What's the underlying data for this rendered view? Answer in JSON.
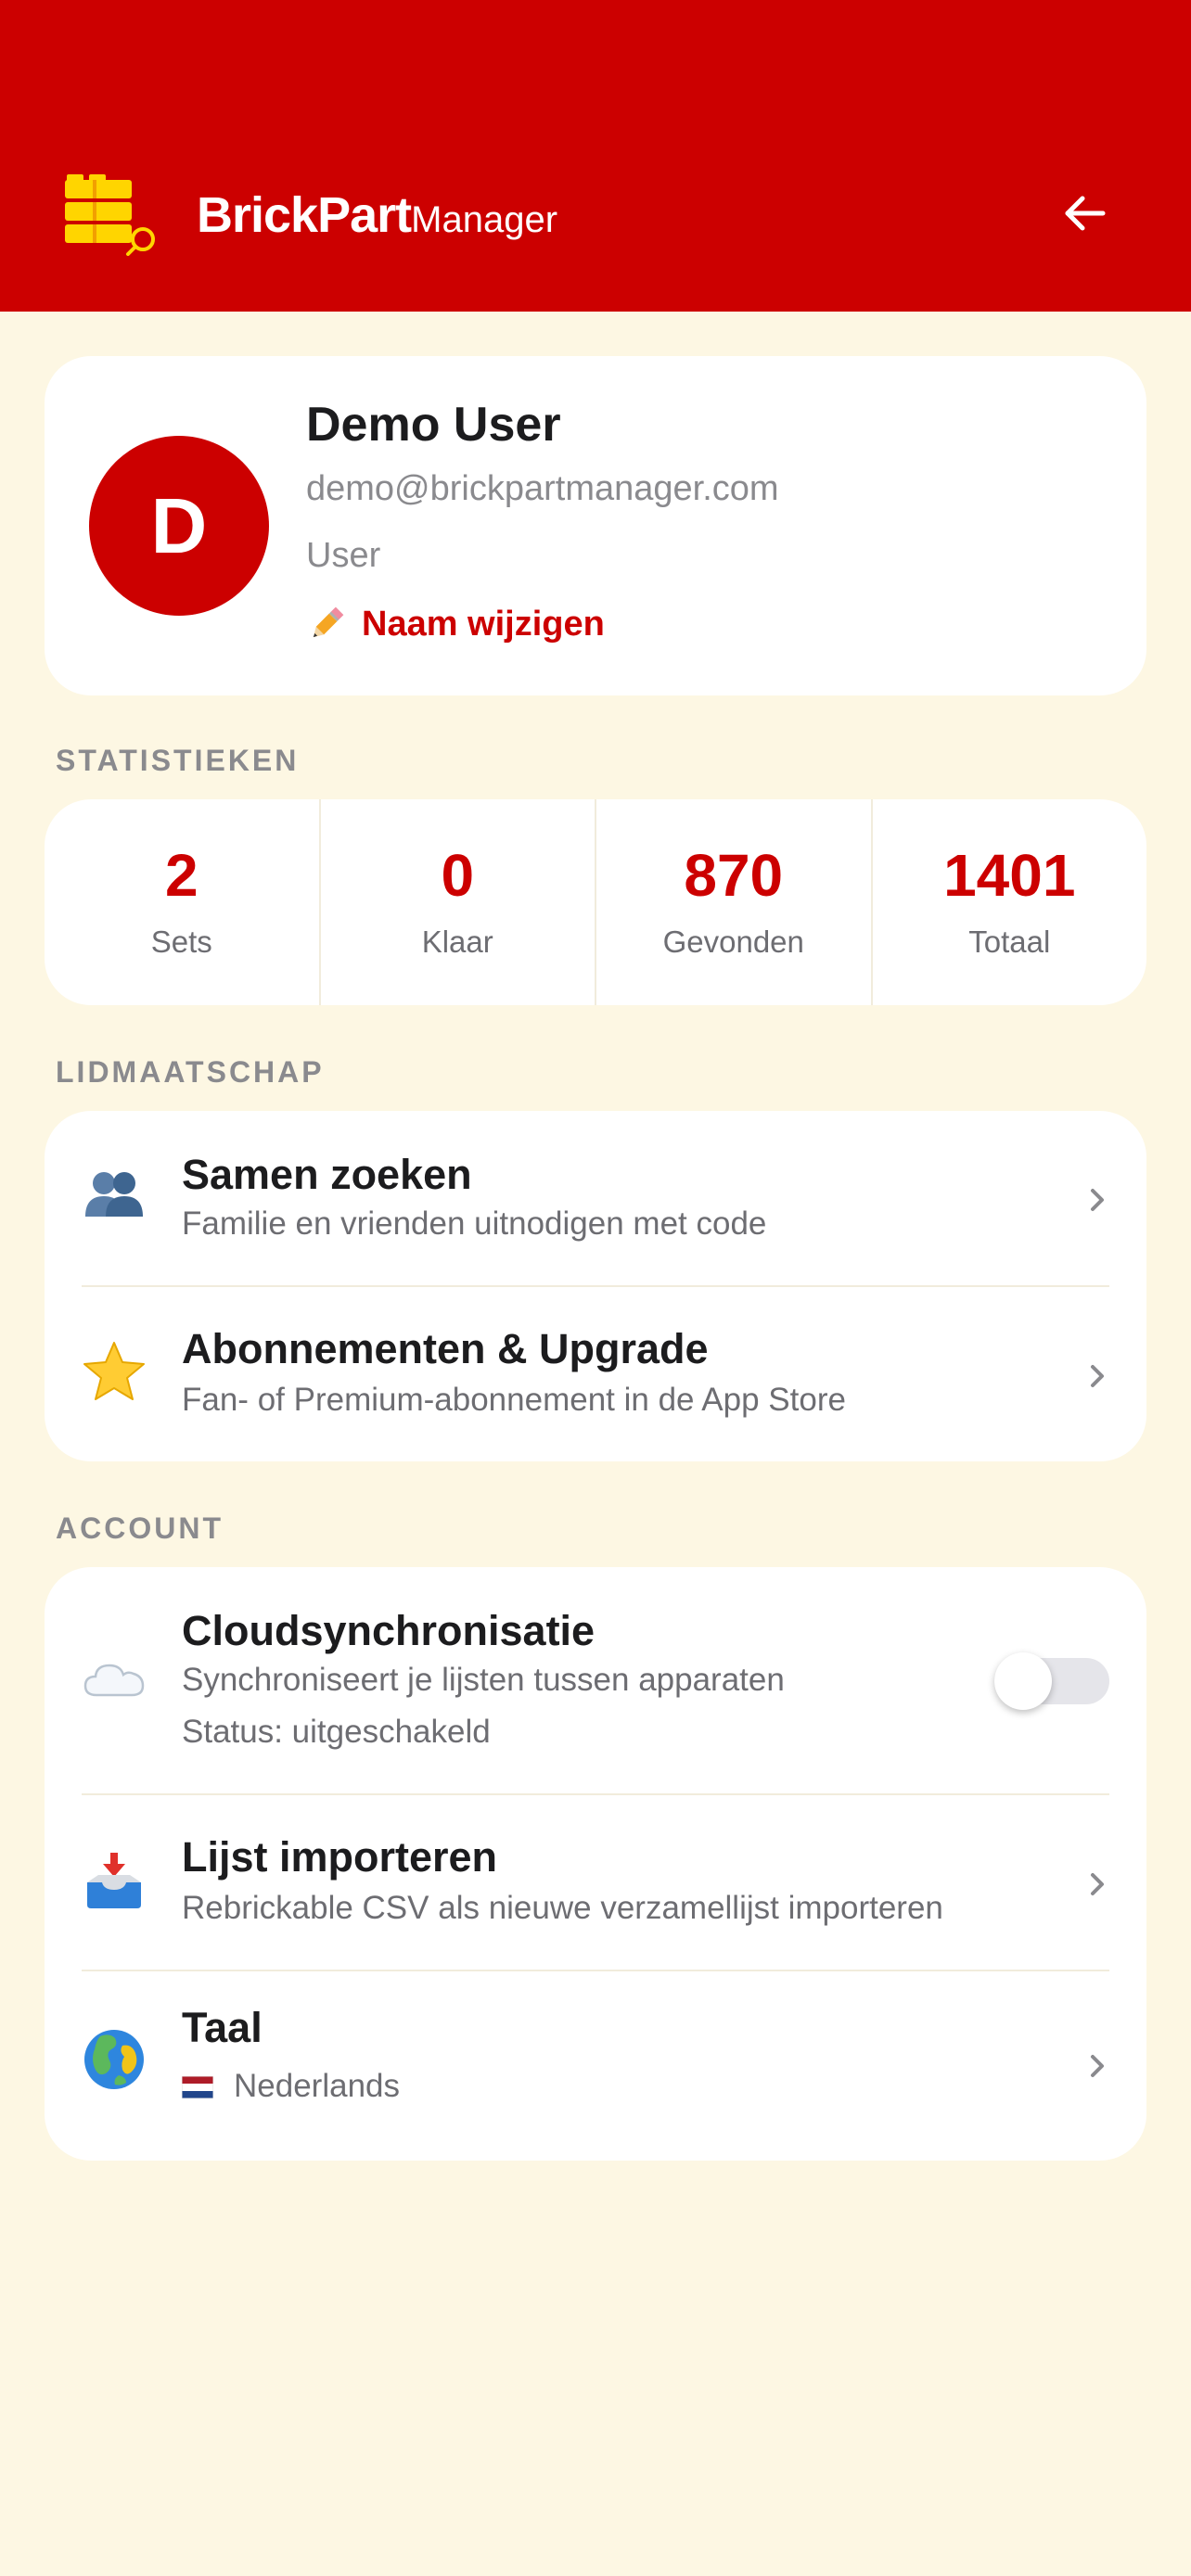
{
  "header": {
    "brand_bold": "BrickPart",
    "brand_light": "Manager",
    "back_icon": "arrow-left-icon",
    "logo_icon": "brick-search-logo-icon",
    "background": "#cc0000"
  },
  "profile": {
    "initial": "D",
    "name": "Demo User",
    "email": "demo@brickpartmanager.com",
    "role": "User",
    "edit_label": "Naam wijzigen",
    "edit_icon": "pencil-icon"
  },
  "stats": {
    "section_title": "STATISTIEKEN",
    "items": [
      {
        "value": "2",
        "label": "Sets"
      },
      {
        "value": "0",
        "label": "Klaar"
      },
      {
        "value": "870",
        "label": "Gevonden"
      },
      {
        "value": "1401",
        "label": "Totaal"
      }
    ]
  },
  "membership": {
    "section_title": "LIDMAATSCHAP",
    "items": [
      {
        "title": "Samen zoeken",
        "subtitle": "Familie en vrienden uitnodigen met code",
        "icon": "people-icon"
      },
      {
        "title": "Abonnementen & Upgrade",
        "subtitle": "Fan- of Premium-abonnement in de App Store",
        "icon": "star-icon"
      }
    ]
  },
  "account": {
    "section_title": "ACCOUNT",
    "cloud": {
      "title": "Cloudsynchronisatie",
      "subtitle": "Synchroniseert je lijsten tussen apparaten",
      "status": "Status: uitgeschakeld",
      "enabled": false,
      "icon": "cloud-icon"
    },
    "import": {
      "title": "Lijst importeren",
      "subtitle": "Rebrickable CSV als nieuwe verzamellijst importeren",
      "icon": "inbox-tray-icon"
    },
    "language": {
      "title": "Taal",
      "value": "Nederlands",
      "icon": "globe-icon",
      "flag_icon": "dutch-flag-icon"
    }
  },
  "colors": {
    "accent": "#cc0000",
    "background": "#fdf7e3",
    "secondary_text": "#8a8a8e"
  }
}
